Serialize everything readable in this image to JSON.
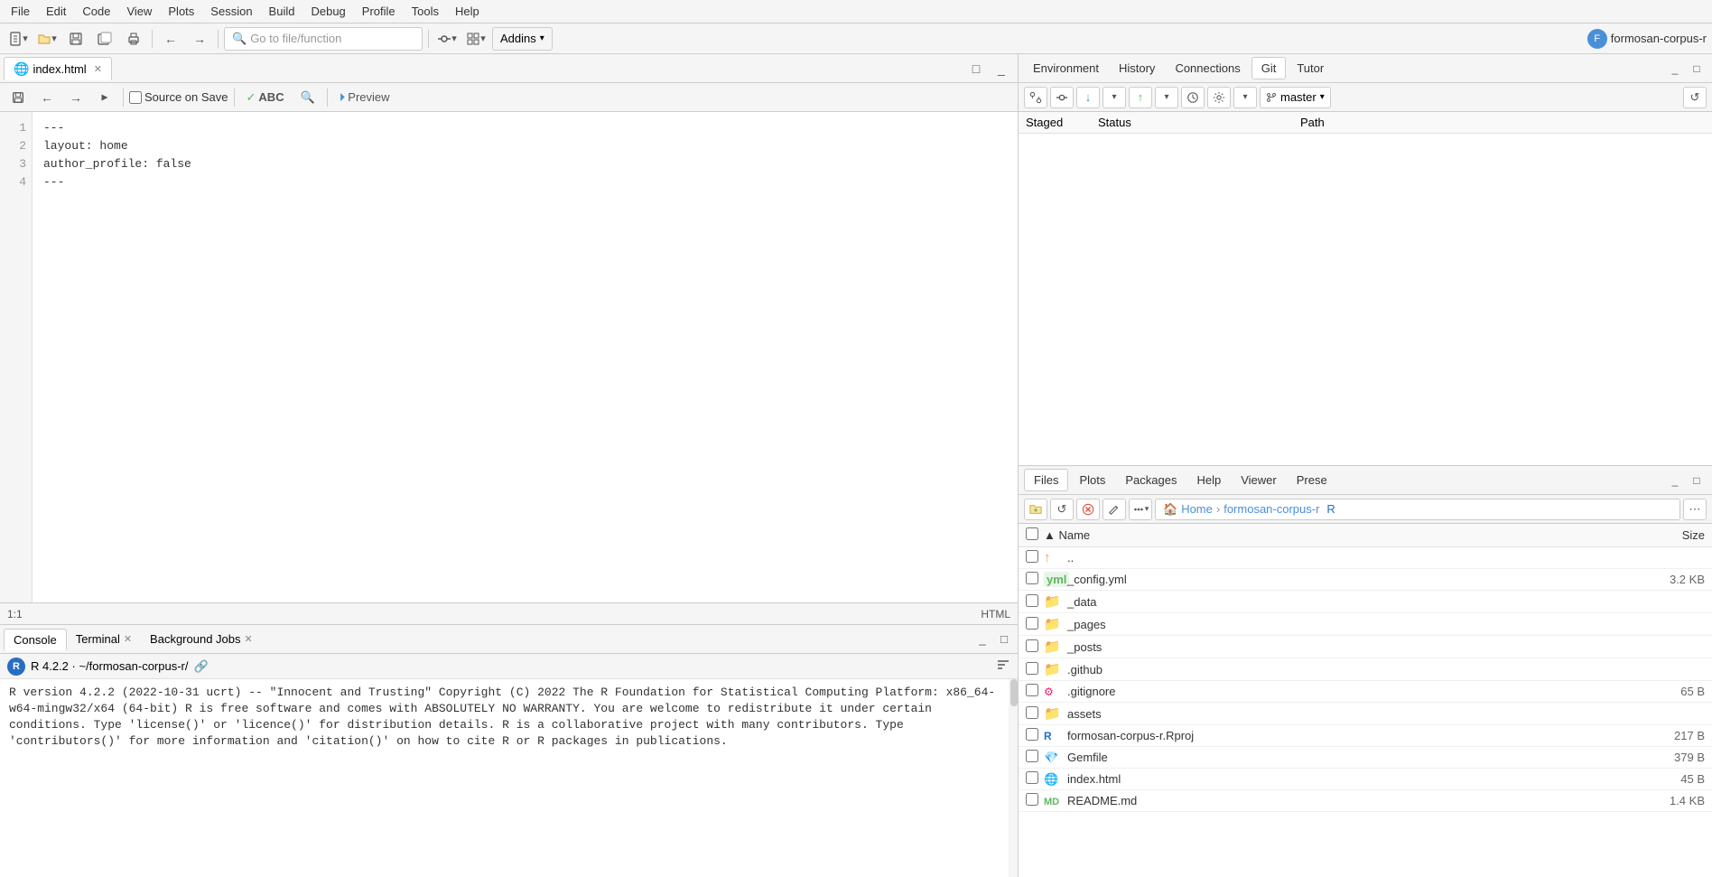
{
  "menubar": {
    "items": [
      "File",
      "Edit",
      "Code",
      "View",
      "Plots",
      "Session",
      "Build",
      "Debug",
      "Profile",
      "Tools",
      "Help"
    ]
  },
  "toolbar": {
    "goto_placeholder": "Go to file/function",
    "addins_label": "Addins",
    "user_label": "formosan-corpus-r",
    "user_initials": "F"
  },
  "editor": {
    "tab_label": "index.html",
    "source_on_save": "Source on Save",
    "preview_label": "Preview",
    "lines": [
      "---",
      "layout: home",
      "author_profile: false",
      "---"
    ],
    "statusbar_pos": "1:1",
    "statusbar_type": "HTML"
  },
  "console": {
    "tabs": [
      {
        "label": "Console",
        "closeable": false
      },
      {
        "label": "Terminal",
        "closeable": true
      },
      {
        "label": "Background Jobs",
        "closeable": true
      }
    ],
    "r_version_line": "R 4.2.2 · ~/formosan-corpus-r/",
    "content_lines": [
      "R version 4.2.2 (2022-10-31 ucrt) -- \"Innocent and Trusting\"",
      "Copyright (C) 2022 The R Foundation for Statistical Computing",
      "Platform: x86_64-w64-mingw32/x64 (64-bit)",
      "",
      "R is free software and comes with ABSOLUTELY NO WARRANTY.",
      "You are welcome to redistribute it under certain conditions.",
      "Type 'license()' or 'licence()' for distribution details.",
      "",
      "R is a collaborative project with many contributors.",
      "Type 'contributors()' for more information and",
      "'citation()' on how to cite R or R packages in publications."
    ]
  },
  "right_top": {
    "tabs": [
      "Environment",
      "History",
      "Connections",
      "Git",
      "Tutor"
    ],
    "active_tab": "Git",
    "git_toolbar": {
      "branch": "master"
    },
    "git_columns": {
      "staged": "Staged",
      "status": "Status",
      "path": "Path"
    }
  },
  "right_bottom": {
    "tabs": [
      "Files",
      "Plots",
      "Packages",
      "Help",
      "Viewer",
      "Prese"
    ],
    "active_tab": "Files",
    "breadcrumb": {
      "home": "Home",
      "current": "formosan-corpus-r"
    },
    "columns": {
      "name": "Name",
      "size": "Size"
    },
    "files": [
      {
        "name": "..",
        "type": "parent",
        "size": ""
      },
      {
        "name": "_config.yml",
        "type": "yaml",
        "size": "3.2 KB"
      },
      {
        "name": "_data",
        "type": "folder",
        "size": ""
      },
      {
        "name": "_pages",
        "type": "folder",
        "size": ""
      },
      {
        "name": "_posts",
        "type": "folder",
        "size": ""
      },
      {
        "name": ".github",
        "type": "folder",
        "size": ""
      },
      {
        "name": ".gitignore",
        "type": "gitignore",
        "size": "65 B"
      },
      {
        "name": "assets",
        "type": "folder",
        "size": ""
      },
      {
        "name": "formosan-corpus-r.Rproj",
        "type": "rproj",
        "size": "217 B"
      },
      {
        "name": "Gemfile",
        "type": "gem",
        "size": "379 B"
      },
      {
        "name": "index.html",
        "type": "html",
        "size": "45 B"
      },
      {
        "name": "README.md",
        "type": "md",
        "size": "1.4 KB"
      }
    ]
  }
}
